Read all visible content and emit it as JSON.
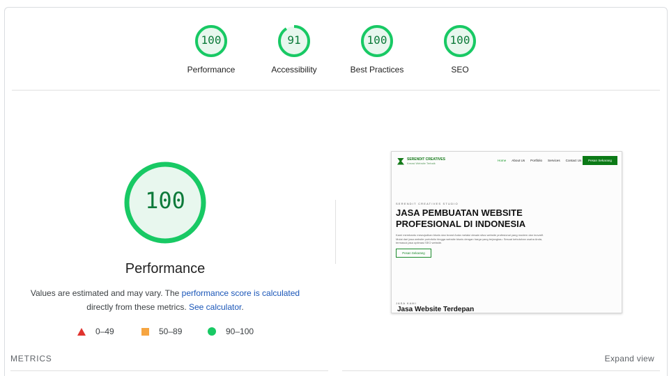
{
  "categories": [
    {
      "label": "Performance",
      "score": "100",
      "fraction": 1.0
    },
    {
      "label": "Accessibility",
      "score": "91",
      "fraction": 0.91
    },
    {
      "label": "Best Practices",
      "score": "100",
      "fraction": 1.0
    },
    {
      "label": "SEO",
      "score": "100",
      "fraction": 1.0
    }
  ],
  "colors": {
    "pass": "#18c964",
    "pass_fill": "#e8f7ee",
    "pass_text": "#0d7a3a",
    "average": "#f6a541",
    "fail": "#e0332e",
    "link": "#1a56b8"
  },
  "main": {
    "score": "100",
    "title": "Performance",
    "desc_prefix": "Values are estimated and may vary. The ",
    "desc_link1": "performance score is calculated",
    "desc_middle": "directly from these metrics. ",
    "desc_link2": "See calculator",
    "desc_suffix": "."
  },
  "legend": [
    {
      "icon": "triangle-icon",
      "label": "0–49"
    },
    {
      "icon": "square-icon",
      "label": "50–89"
    },
    {
      "icon": "circle-icon",
      "label": "90–100"
    }
  ],
  "screenshot": {
    "logo_name": "SERENDIT CREATIVES",
    "logo_sub": "Kreasi Website Terbaik",
    "nav": [
      "Home",
      "About Us",
      "Portfolio",
      "Services",
      "Contact Us"
    ],
    "nav_button": "Pesan Sekarang",
    "kicker": "SERENDIT CREATIVES STUDIO",
    "headline_line1": "JASA PEMBUATAN WEBSITE",
    "headline_line2": "PROFESIONAL DI INDONESIA",
    "paragraph": "Kami membantu mewujudkan bisnis dan brand Anda melalui desain situs website profesional yang modern dan inovatif. Mulai dari jasa website portofolio hingga website bisnis dengan harga yang terjangkau. Sesuai kebutuhan usaha Anda, termasuk jasa optimasi SEO website.",
    "cta": "Pesan Sekarang",
    "kicker2": "JASA KAMI",
    "headline2": "Jasa Website Terdepan"
  },
  "footer": {
    "metrics_label": "METRICS",
    "expand_label": "Expand view"
  }
}
